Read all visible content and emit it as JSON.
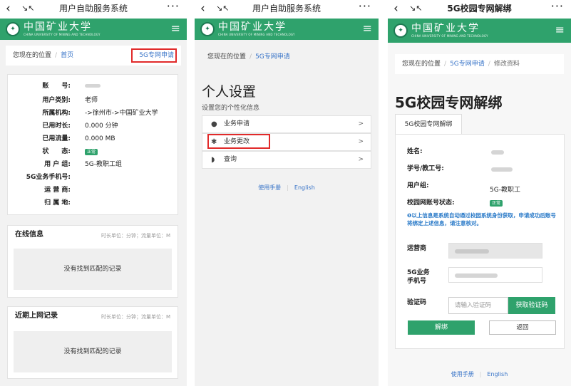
{
  "panel1": {
    "title": "用户自助服务系统",
    "breadcrumb": {
      "prefix": "您现在的位置",
      "home": "首页",
      "current": "5G专网申请"
    },
    "info": [
      {
        "label": "账　　号:",
        "value": ""
      },
      {
        "label": "用户类别:",
        "value": "老师"
      },
      {
        "label": "所属机构:",
        "value": "->徐州市->中国矿业大学"
      },
      {
        "label": "已用时长:",
        "value": "0.000 分钟"
      },
      {
        "label": "已用流量:",
        "value": "0.000 MB"
      },
      {
        "label": "状　　态:",
        "value": "正常"
      },
      {
        "label": "用 户 组:",
        "value": "5G-教职工组"
      },
      {
        "label": "5G业务手机号:",
        "value": ""
      },
      {
        "label": "运 营 商:",
        "value": ""
      },
      {
        "label": "归 属 地:",
        "value": ""
      }
    ],
    "online": {
      "title": "在线信息",
      "units": "时长单位：分钟；流量单位：M",
      "empty": "没有找到匹配的记录"
    },
    "recent": {
      "title": "近期上网记录",
      "units": "时长单位：分钟；流量单位：M",
      "empty": "没有找到匹配的记录"
    }
  },
  "panel2": {
    "breadcrumb": {
      "prefix": "您现在的位置",
      "current": "5G专网申请"
    },
    "title": "个人设置",
    "subtitle": "设置您的个性化信息",
    "menu": [
      {
        "label": "业务申请",
        "icon": "user-icon"
      },
      {
        "label": "业务更改",
        "icon": "asterisk-icon"
      },
      {
        "label": "查询",
        "icon": "shield-icon"
      }
    ],
    "footer": {
      "manual": "使用手册",
      "english": "English"
    }
  },
  "panel3": {
    "title": "5G校园专网解绑",
    "breadcrumb": {
      "prefix": "您现在的位置",
      "mid": "5G专网申请",
      "current": "修改资料"
    },
    "heading": "5G校园专网解绑",
    "tab": "5G校园专网解绑",
    "fields": {
      "name": "姓名:",
      "id": "学号/教工号:",
      "group_label": "用户组:",
      "group_value": "5G-教职工",
      "status_label": "校园网账号状态:",
      "status_value": "正常"
    },
    "note": "❶以上信息是系统自动通过校园系统身份获取，申请成功后账号将绑定上述信息，请注意核对。",
    "carrier_label": "运营商",
    "phone_label_1": "5G业务",
    "phone_label_2": "手机号",
    "code_label": "验证码",
    "code_placeholder": "请输入验证码",
    "get_code": "获取验证码",
    "unbind": "解绑",
    "back": "返回",
    "footer": {
      "manual": "使用手册",
      "english": "English"
    }
  },
  "logo": {
    "cn": "中国矿业大学",
    "en": "CHINA UNIVERSITY OF MINING AND TECHNOLOGY"
  },
  "colors": {
    "brand_green": "#2fa26c",
    "highlight_red": "#e12a2a",
    "link_blue": "#3874c8"
  }
}
